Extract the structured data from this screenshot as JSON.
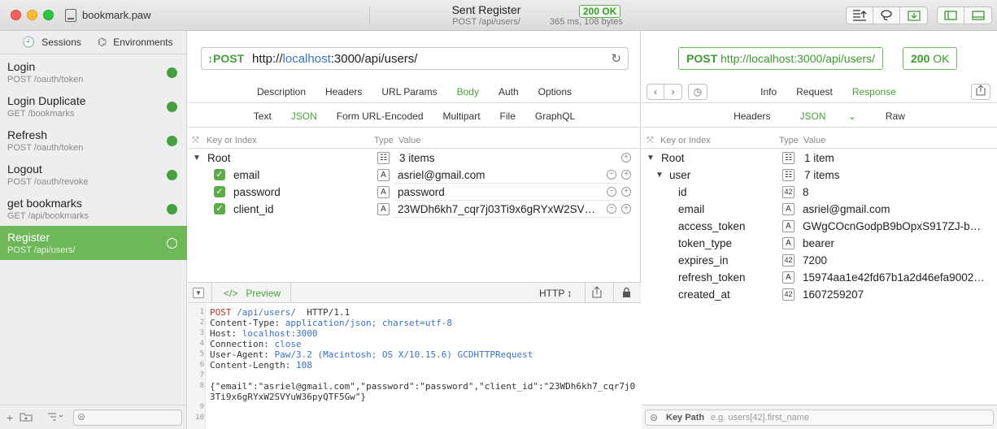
{
  "window": {
    "doc_title": "bookmark.paw",
    "request_title": "Sent Register",
    "request_sub": "POST /api/users/",
    "status": "200 OK",
    "status_sub": "365 ms, 108 bytes"
  },
  "sidebar": {
    "tabs": {
      "sessions": "Sessions",
      "environments": "Environments"
    },
    "items": [
      {
        "name": "Login",
        "sub": "POST /oauth/token"
      },
      {
        "name": "Login Duplicate",
        "sub": "GET /bookmarks"
      },
      {
        "name": "Refresh",
        "sub": "POST /oauth/token"
      },
      {
        "name": "Logout",
        "sub": "POST /oauth/revoke"
      },
      {
        "name": "get bookmarks",
        "sub": "GET /api/bookmarks"
      },
      {
        "name": "Register",
        "sub": "POST /api/users/"
      }
    ]
  },
  "request": {
    "method": "POST",
    "url_prefix": "http://",
    "url_host": "localhost",
    "url_suffix": ":3000/api/users/",
    "tabs": [
      "Description",
      "Headers",
      "URL Params",
      "Body",
      "Auth",
      "Options"
    ],
    "body_tabs": [
      "Text",
      "JSON",
      "Form URL-Encoded",
      "Multipart",
      "File",
      "GraphQL"
    ],
    "kv_header": {
      "key": "Key or Index",
      "type": "Type",
      "value": "Value"
    },
    "root": {
      "key": "Root",
      "value": "3 items"
    },
    "fields": [
      {
        "key": "email",
        "value": "asriel@gmail.com"
      },
      {
        "key": "password",
        "value": "password"
      },
      {
        "key": "client_id",
        "value": "23WDh6kh7_cqr7j03Ti9x6gRYxW2SVY…"
      }
    ],
    "type_object": "☷",
    "type_string": "A"
  },
  "preview": {
    "label": "Preview",
    "format": "HTTP",
    "lines": [
      {
        "n": "1",
        "parts": [
          [
            "r",
            "POST "
          ],
          [
            "b",
            "/api/users/"
          ],
          [
            "",
            "  HTTP/1.1"
          ]
        ]
      },
      {
        "n": "2",
        "parts": [
          [
            "",
            "Content-Type: "
          ],
          [
            "b",
            "application/json; charset=utf-8"
          ]
        ]
      },
      {
        "n": "3",
        "parts": [
          [
            "",
            "Host: "
          ],
          [
            "b",
            "localhost:3000"
          ]
        ]
      },
      {
        "n": "4",
        "parts": [
          [
            "",
            "Connection: "
          ],
          [
            "b",
            "close"
          ]
        ]
      },
      {
        "n": "5",
        "parts": [
          [
            "",
            "User-Agent: "
          ],
          [
            "b",
            "Paw/3.2 (Macintosh; OS X/10.15.6) GCDHTTPRequest"
          ]
        ]
      },
      {
        "n": "6",
        "parts": [
          [
            "",
            "Content-Length: "
          ],
          [
            "b",
            "108"
          ]
        ]
      },
      {
        "n": "7",
        "parts": []
      },
      {
        "n": "8",
        "parts": [
          [
            "",
            "{\"email\":\"asriel@gmail.com\",\"password\":\"password\",\"client_id\":\"23WDh6kh7_cqr7j0"
          ]
        ]
      },
      {
        "n": "",
        "parts": [
          [
            "",
            "3Ti9x6gRYxW2SVYuW36pyQTF5Gw\"}"
          ]
        ]
      },
      {
        "n": "9",
        "parts": []
      },
      {
        "n": "10",
        "parts": []
      }
    ]
  },
  "response": {
    "method": "POST",
    "url": "http://localhost:3000/api/users/",
    "code": "200",
    "code_text": "OK",
    "tabs": [
      "Info",
      "Request",
      "Response"
    ],
    "sub_tabs": [
      "Headers",
      "JSON",
      "Raw"
    ],
    "root": {
      "key": "Root",
      "value": "1 item"
    },
    "user": {
      "key": "user",
      "value": "7 items"
    },
    "fields": [
      {
        "key": "id",
        "type": "42",
        "value": "8"
      },
      {
        "key": "email",
        "type": "A",
        "value": "asriel@gmail.com"
      },
      {
        "key": "access_token",
        "type": "A",
        "value": "GWgCOcnGodpB9bOpxS917ZJ-bn…"
      },
      {
        "key": "token_type",
        "type": "A",
        "value": "bearer"
      },
      {
        "key": "expires_in",
        "type": "42",
        "value": "7200"
      },
      {
        "key": "refresh_token",
        "type": "A",
        "value": "15974aa1e42fd67b1a2d46efa9002…"
      },
      {
        "key": "created_at",
        "type": "42",
        "value": "1607259207"
      }
    ],
    "keypath_label": "Key Path",
    "keypath_placeholder": "e.g. users[42].first_name"
  }
}
